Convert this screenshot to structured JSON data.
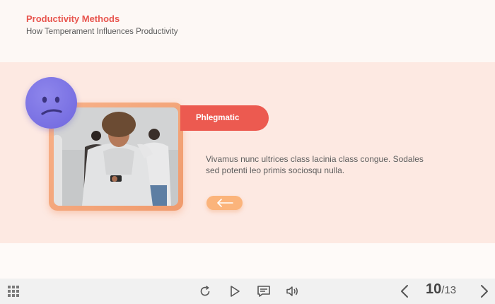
{
  "header": {
    "title": "Productivity Methods",
    "subtitle": "How Temperament Influences Productivity"
  },
  "card": {
    "tag_label": "Phlegmatic",
    "emoji_icon": "confused-face-icon",
    "photo_alt": "Photo of a young man in a hoodie holding a phone, people standing behind",
    "description": "Vivamus nunc ultrices class lacinia class congue. Sodales sed potenti leo primis sociosqu nulla.",
    "back_icon": "arrow-left-icon"
  },
  "toolbar": {
    "menu_icon": "grid-menu-icon",
    "replay_icon": "replay-icon",
    "play_icon": "play-icon",
    "captions_icon": "captions-icon",
    "volume_icon": "volume-icon",
    "prev_icon": "chevron-left-icon",
    "next_icon": "chevron-right-icon",
    "current_page": "10",
    "total_pages": "/13"
  },
  "colors": {
    "accent_red": "#ec5a50",
    "title_red": "#e8554e",
    "band_background": "#fde9e2",
    "emoji_purple": "#7a72e6",
    "button_orange": "#fbb47b"
  }
}
